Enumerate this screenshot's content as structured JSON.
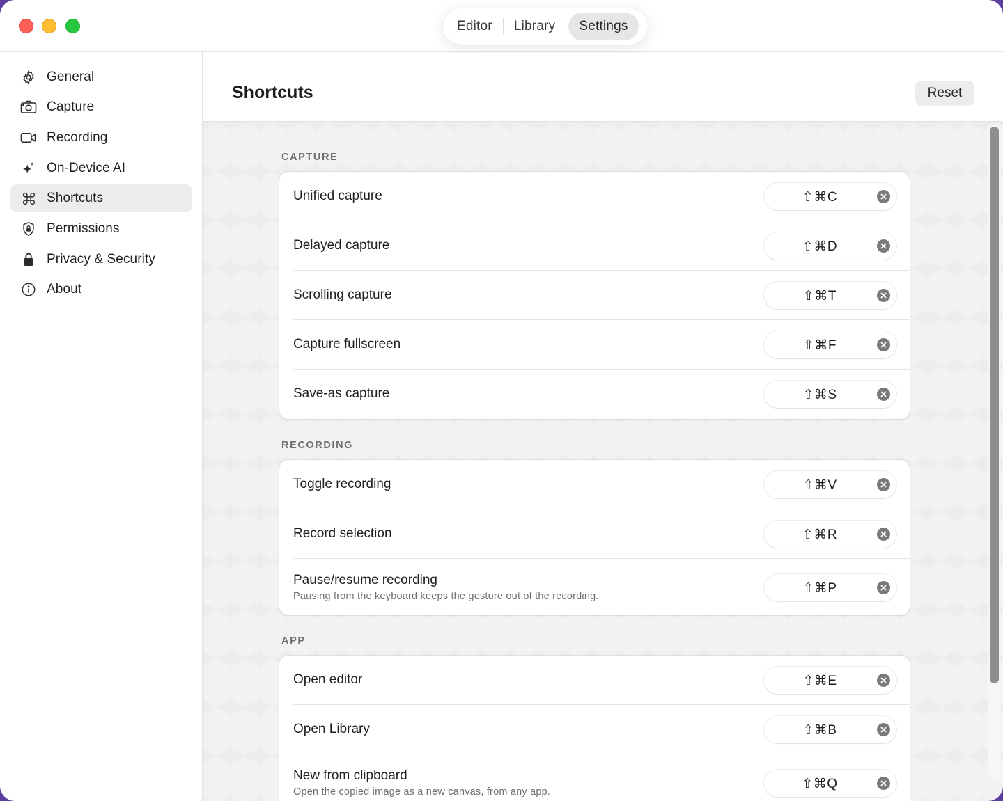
{
  "window": {
    "tabs": [
      {
        "label": "Editor",
        "active": false
      },
      {
        "label": "Library",
        "active": false
      },
      {
        "label": "Settings",
        "active": true
      }
    ]
  },
  "sidebar": {
    "items": [
      {
        "label": "General",
        "icon": "gear-icon",
        "active": false
      },
      {
        "label": "Capture",
        "icon": "camera-icon",
        "active": false
      },
      {
        "label": "Recording",
        "icon": "video-camera-icon",
        "active": false
      },
      {
        "label": "On-Device AI",
        "icon": "sparkles-icon",
        "active": false
      },
      {
        "label": "Shortcuts",
        "icon": "command-icon",
        "active": true
      },
      {
        "label": "Permissions",
        "icon": "shield-lock-icon",
        "active": false
      },
      {
        "label": "Privacy & Security",
        "icon": "lock-icon",
        "active": false
      },
      {
        "label": "About",
        "icon": "info-icon",
        "active": false
      }
    ]
  },
  "header": {
    "title": "Shortcuts",
    "reset_label": "Reset"
  },
  "sections": [
    {
      "title": "CAPTURE",
      "rows": [
        {
          "label": "Unified capture",
          "shortcut": "⇧⌘C"
        },
        {
          "label": "Delayed capture",
          "shortcut": "⇧⌘D"
        },
        {
          "label": "Scrolling capture",
          "shortcut": "⇧⌘T"
        },
        {
          "label": "Capture fullscreen",
          "shortcut": "⇧⌘F"
        },
        {
          "label": "Save-as capture",
          "shortcut": "⇧⌘S"
        }
      ]
    },
    {
      "title": "RECORDING",
      "rows": [
        {
          "label": "Toggle recording",
          "shortcut": "⇧⌘V"
        },
        {
          "label": "Record selection",
          "shortcut": "⇧⌘R"
        },
        {
          "label": "Pause/resume recording",
          "subtitle": "Pausing from the keyboard keeps the gesture out of the recording.",
          "shortcut": "⇧⌘P"
        }
      ]
    },
    {
      "title": "APP",
      "rows": [
        {
          "label": "Open editor",
          "shortcut": "⇧⌘E"
        },
        {
          "label": "Open Library",
          "shortcut": "⇧⌘B"
        },
        {
          "label": "New from clipboard",
          "subtitle": "Open the copied image as a new canvas, from any app.",
          "shortcut": "⇧⌘Q"
        }
      ]
    }
  ],
  "colors": {
    "close": "#fe5f57",
    "minimize": "#febc2e",
    "zoom": "#28c840",
    "content_bg": "#f2f1f3"
  }
}
